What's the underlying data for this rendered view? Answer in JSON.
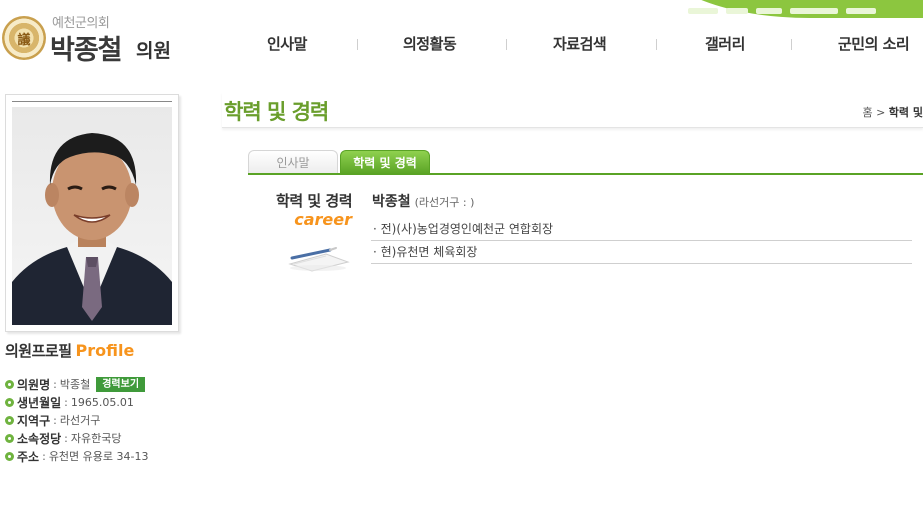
{
  "header": {
    "council_name": "예천군의회",
    "member_name": "박종철",
    "member_suffix": "의원",
    "seal_char": "議"
  },
  "nav": {
    "items": [
      "인사말",
      "의정활동",
      "자료검색",
      "갤러리",
      "군민의 소리"
    ]
  },
  "page": {
    "title": "학력 및 경력",
    "breadcrumb_home": "홈",
    "breadcrumb_sep": ">",
    "breadcrumb_current": "학력 및"
  },
  "tabs": [
    "인사말",
    "학력 및 경력"
  ],
  "career": {
    "heading_ko": "학력 및 경력",
    "heading_en": "career",
    "name": "박종철",
    "district": "(라선거구 : )",
    "items": [
      "· 전)(사)농업경영인예천군 연합회장",
      "· 현)유천면 체육회장"
    ]
  },
  "profile": {
    "title_ko": "의원프로필",
    "title_en": "Profile",
    "fields": [
      {
        "label": "의원명",
        "value": "박종철",
        "badge": "경력보기"
      },
      {
        "label": "생년월일",
        "value": "1965.05.01"
      },
      {
        "label": "지역구",
        "value": "라선거구"
      },
      {
        "label": "소속정당",
        "value": "자유한국당"
      },
      {
        "label": "주소",
        "value": "유천면 유용로 34-13"
      }
    ]
  },
  "colors": {
    "accent_green": "#6a9e2c",
    "tab_green": "#5aa325",
    "accent_orange": "#f7941d"
  }
}
